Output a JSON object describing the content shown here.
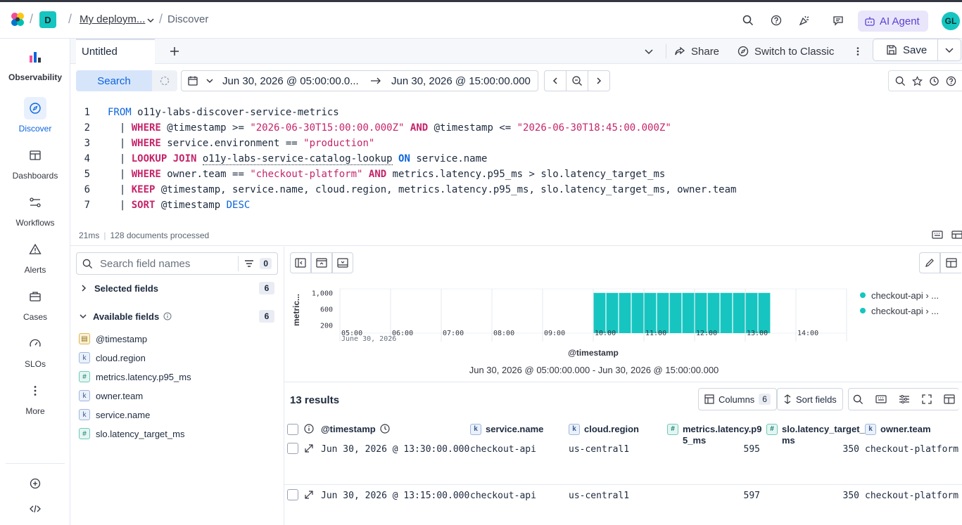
{
  "topbar": {
    "deployment_badge": "D",
    "deployment_name": "My deploym...",
    "current_page": "Discover",
    "ai_agent_label": "AI Agent",
    "avatar_initials": "GL"
  },
  "sidenav": {
    "items": [
      {
        "label": "Observability",
        "icon": "observability-icon"
      },
      {
        "label": "Discover",
        "icon": "discover-icon",
        "active": true
      },
      {
        "label": "Dashboards",
        "icon": "dashboards-icon"
      },
      {
        "label": "Workflows",
        "icon": "workflows-icon"
      },
      {
        "label": "Alerts",
        "icon": "alerts-icon"
      },
      {
        "label": "Cases",
        "icon": "cases-icon"
      },
      {
        "label": "SLOs",
        "icon": "slos-icon"
      },
      {
        "label": "More",
        "icon": "more-icon"
      }
    ]
  },
  "tabs": {
    "active_tab": "Untitled",
    "share_label": "Share",
    "switch_label": "Switch to Classic",
    "save_label": "Save"
  },
  "querybar": {
    "search_label": "Search",
    "date_start": "Jun 30, 2026 @ 05:00:00.0...",
    "date_end": "Jun 30, 2026 @ 15:00:00.000"
  },
  "editor": {
    "line_numbers": [
      "1",
      "2",
      "3",
      "4",
      "5",
      "6",
      "7"
    ],
    "l1": {
      "kw": "FROM",
      "rest": " o11y-labs-discover-service-metrics"
    },
    "l2": {
      "pipe": "  | ",
      "kw": "WHERE",
      "a": " @timestamp >= ",
      "s1": "\"2026-06-30T15:00:00.000Z\"",
      "and": " AND",
      "b": " @timestamp <= ",
      "s2": "\"2026-06-30T18:45:00.000Z\""
    },
    "l3": {
      "pipe": "  | ",
      "kw": "WHERE",
      "a": " service.environment == ",
      "s1": "\"production\""
    },
    "l4": {
      "pipe": "  | ",
      "kw": "LOOKUP JOIN",
      "idx": "o11y-labs-service-catalog-lookup",
      "on": "ON",
      "b": " service.name"
    },
    "l5": {
      "pipe": "  | ",
      "kw": "WHERE",
      "a": " owner.team == ",
      "s1": "\"checkout-platform\"",
      "and": " AND",
      "b": " metrics.latency.p95_ms > slo.latency_target_ms"
    },
    "l6": {
      "pipe": "  | ",
      "kw": "KEEP",
      "a": " @timestamp, service.name, cloud.region, metrics.latency.p95_ms, slo.latency_target_ms, owner.team"
    },
    "l7": {
      "pipe": "  | ",
      "kw": "SORT",
      "a": " @timestamp ",
      "dir": "DESC"
    }
  },
  "status": {
    "duration": "21ms",
    "processed": "128 documents processed"
  },
  "fields": {
    "search_placeholder": "Search field names",
    "filter_count": "0",
    "selected_label": "Selected fields",
    "selected_count": "6",
    "available_label": "Available fields",
    "available_count": "6",
    "list": [
      {
        "name": "@timestamp",
        "type": "date"
      },
      {
        "name": "cloud.region",
        "type": "keyword"
      },
      {
        "name": "metrics.latency.p95_ms",
        "type": "number"
      },
      {
        "name": "owner.team",
        "type": "keyword"
      },
      {
        "name": "service.name",
        "type": "keyword"
      },
      {
        "name": "slo.latency_target_ms",
        "type": "number"
      }
    ]
  },
  "chart_data": {
    "type": "bar",
    "xlabel": "@timestamp",
    "ylabel": "metric...",
    "x_ticks": [
      "05:00",
      "06:00",
      "07:00",
      "08:00",
      "09:00",
      "10:00",
      "11:00",
      "12:00",
      "13:00",
      "14:00"
    ],
    "x_sub_label": "June 30, 2026",
    "y_ticks": [
      "1,000",
      "600",
      "200"
    ],
    "ylim": [
      0,
      1100
    ],
    "bar_color": "#16c5c0",
    "series": [
      {
        "name": "checkout-api › ...",
        "x": [
          "10:15",
          "10:30",
          "10:45",
          "11:00",
          "11:15",
          "11:30",
          "11:45",
          "12:00",
          "12:15",
          "12:30",
          "12:45",
          "13:00",
          "13:15",
          "13:30"
        ],
        "values": [
          1000,
          1000,
          1000,
          1000,
          1000,
          1000,
          1000,
          1000,
          1000,
          1000,
          1000,
          1000,
          1000,
          1000
        ]
      }
    ],
    "legend": [
      "checkout-api › ...",
      "checkout-api › ..."
    ],
    "range_label": "Jun 30, 2026 @ 05:00:00.000 - Jun 30, 2026 @ 15:00:00.000"
  },
  "results": {
    "count_label": "13 results",
    "columns_label": "Columns",
    "columns_count": "6",
    "sort_label": "Sort fields",
    "headers": {
      "timestamp": "@timestamp",
      "service": "service.name",
      "region": "cloud.region",
      "latency_a": "metrics.latency.p9",
      "latency_b": "5_ms",
      "slo_a": "slo.latency_target_",
      "slo_b": "ms",
      "team": "owner.team"
    },
    "rows": [
      {
        "timestamp": "Jun 30, 2026 @ 13:30:00.000",
        "service": "checkout-api",
        "region": "us-central1",
        "latency": "595",
        "slo": "350",
        "team": "checkout-platform"
      },
      {
        "timestamp": "Jun 30, 2026 @ 13:15:00.000",
        "service": "checkout-api",
        "region": "us-central1",
        "latency": "597",
        "slo": "350",
        "team": "checkout-platform"
      }
    ]
  }
}
